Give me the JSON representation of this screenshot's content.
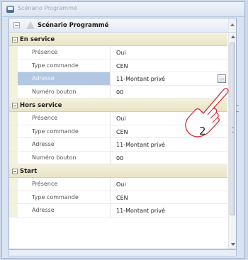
{
  "window": {
    "title": "Scénario Programmé"
  },
  "panel": {
    "header_title": "Scénario Programmé"
  },
  "sections": [
    {
      "label": "En service",
      "rows": [
        {
          "name": "Présence",
          "value": "Oui"
        },
        {
          "name": "Type commande",
          "value": "CEN"
        },
        {
          "name": "Adresse",
          "value": "11-Montant privé",
          "selected": true,
          "has_button": true,
          "button_label": "..."
        },
        {
          "name": "Numéro bouton",
          "value": "00"
        }
      ]
    },
    {
      "label": "Hors service",
      "rows": [
        {
          "name": "Présence",
          "value": "Oui"
        },
        {
          "name": "Type commande",
          "value": "CEN"
        },
        {
          "name": "Adresse",
          "value": "11-Montant privé"
        },
        {
          "name": "Numéro bouton",
          "value": "00"
        }
      ]
    },
    {
      "label": "Start",
      "rows": [
        {
          "name": "Présence",
          "value": "Oui"
        },
        {
          "name": "Type commande",
          "value": "CEN"
        },
        {
          "name": "Adresse",
          "value": "11-Montant privé"
        }
      ]
    }
  ],
  "annotation": {
    "number": "2",
    "color": "#d9262b",
    "icon": "pointing-hand-icon"
  },
  "colors": {
    "category_bg": "#f4f1de",
    "selected_row": "#b3c7e2",
    "border": "#9fb1cc"
  }
}
